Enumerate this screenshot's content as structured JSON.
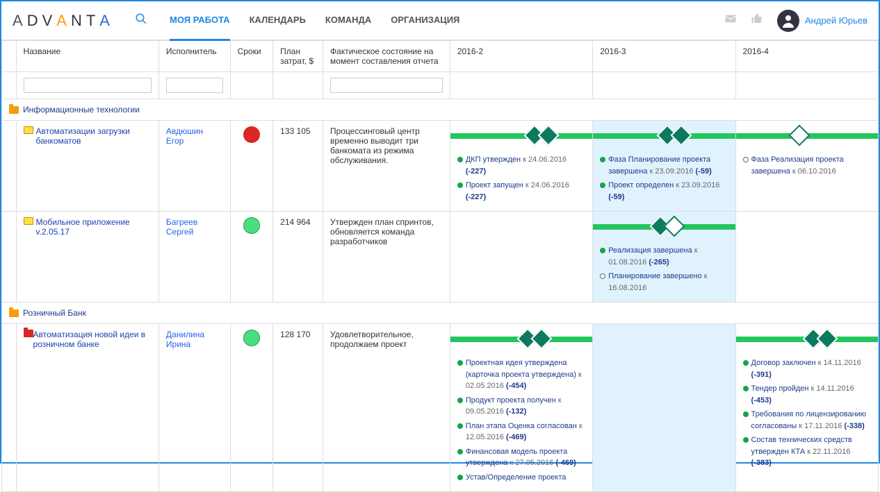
{
  "header": {
    "logo_text": "ADVANTA",
    "nav": [
      {
        "label": "МОЯ РАБОТА",
        "active": true
      },
      {
        "label": "КАЛЕНДАРЬ",
        "active": false
      },
      {
        "label": "КОМАНДА",
        "active": false
      },
      {
        "label": "ОРГАНИЗАЦИЯ",
        "active": false
      }
    ],
    "user_name": "Андрей Юрьев"
  },
  "columns": {
    "name": "Название",
    "assignee": "Исполнитель",
    "deadline": "Сроки",
    "cost": "План затрат, $",
    "status": "Фактическое состояние на момент составления отчета",
    "q2": "2016-2",
    "q3": "2016-3",
    "q4": "2016-4"
  },
  "groups": [
    {
      "title": "Информационные технологии",
      "rows": [
        {
          "name": "Автоматизации загрузки банкоматов",
          "assignee": "Авдюшин Егор",
          "deadline_color": "red",
          "cost": "133 105",
          "status": "Процессинговый центр временно выводит три банкомата из режима обслуживания.",
          "diamonds": {
            "q2": [
              {
                "l": "110px",
                "t": "f"
              },
              {
                "l": "130px",
                "t": "f"
              }
            ],
            "q3": [
              {
                "l": "96px",
                "t": "f"
              },
              {
                "l": "116px",
                "t": "f"
              }
            ],
            "q4": [
              {
                "l": "80px",
                "t": "o"
              }
            ]
          },
          "q2": [
            {
              "dot": "green",
              "text": "ДКП утвержден",
              "date": "к 24.06.2016",
              "var": "(-227)"
            },
            {
              "dot": "green",
              "text": "Проект запущен",
              "date": "к 24.06.2016",
              "var": "(-227)"
            }
          ],
          "q3": [
            {
              "dot": "green",
              "text": "Фаза Планирование проекта завершена",
              "date": "к 23.09.2016",
              "var": "(-59)"
            },
            {
              "dot": "green",
              "text": "Проект определен",
              "date": "к 23.09.2016",
              "var": "(-59)"
            }
          ],
          "q4": [
            {
              "dot": "outline",
              "text": "Фаза Реализация проекта завершена",
              "date": "к 06.10.2016",
              "var": ""
            }
          ],
          "q3_highlight": true
        },
        {
          "name": "Мобильное приложение v.2.05.17",
          "assignee": "Багреев Сергей",
          "deadline_color": "green-stroke",
          "cost": "214 964",
          "status": "Утвержден план спринтов, обновляется команда разработчиков",
          "diamonds": {
            "q2": [],
            "q3": [
              {
                "l": "86px",
                "t": "f"
              },
              {
                "l": "106px",
                "t": "o"
              }
            ],
            "q4": []
          },
          "q2": [],
          "q3": [
            {
              "dot": "green",
              "text": "Реализация завершена",
              "date": "к 01.08.2016",
              "var": "(-265)"
            },
            {
              "dot": "outline",
              "text": "Планирование завершено",
              "date": "к 16.08.2016",
              "var": ""
            }
          ],
          "q4": [],
          "q3_highlight": true
        }
      ]
    },
    {
      "title": "Розничный Банк",
      "rows": [
        {
          "name": "Автоматизация новой идеи в розничном банке",
          "red_folder": true,
          "assignee": "Данилина Ирина",
          "deadline_color": "green-stroke",
          "cost": "128 170",
          "status": "Удовлетворительное, продолжаем проект",
          "diamonds": {
            "q2": [
              {
                "l": "100px",
                "t": "f"
              },
              {
                "l": "120px",
                "t": "f"
              }
            ],
            "q3": [],
            "q4": [
              {
                "l": "100px",
                "t": "f"
              },
              {
                "l": "120px",
                "t": "f"
              }
            ]
          },
          "q2": [
            {
              "dot": "green",
              "text": "Проектная идея утверждена (карточка проекта утверждена)",
              "date": "к 02.05.2016",
              "var": "(-454)"
            },
            {
              "dot": "green",
              "text": "Продукт проекта получен",
              "date": "к 09.05.2016",
              "var": "(-132)"
            },
            {
              "dot": "green",
              "text": "План этапа Оценка согласован",
              "date": "к 12.05.2016",
              "var": "(-469)"
            },
            {
              "dot": "green",
              "text": "Финансовая модель проекта утверждена",
              "date": "к 27.05.2016",
              "var": "(-469)"
            },
            {
              "dot": "green",
              "text": "Устав/Определение проекта",
              "date": "",
              "var": ""
            }
          ],
          "q3": [],
          "q4": [
            {
              "dot": "green",
              "text": "Договор заключен",
              "date": "к 14.11.2016",
              "var": "(-391)"
            },
            {
              "dot": "green",
              "text": "Тендер пройден",
              "date": "к 14.11.2016",
              "var": "(-453)"
            },
            {
              "dot": "green",
              "text": "Требования по лицензированию согласованы",
              "date": "к 17.11.2016",
              "var": "(-338)"
            },
            {
              "dot": "green",
              "text": "Состав технических средств утвержден КТА",
              "date": "к 22.11.2016",
              "var": "(-383)"
            }
          ],
          "q3_highlight": true
        }
      ]
    }
  ]
}
